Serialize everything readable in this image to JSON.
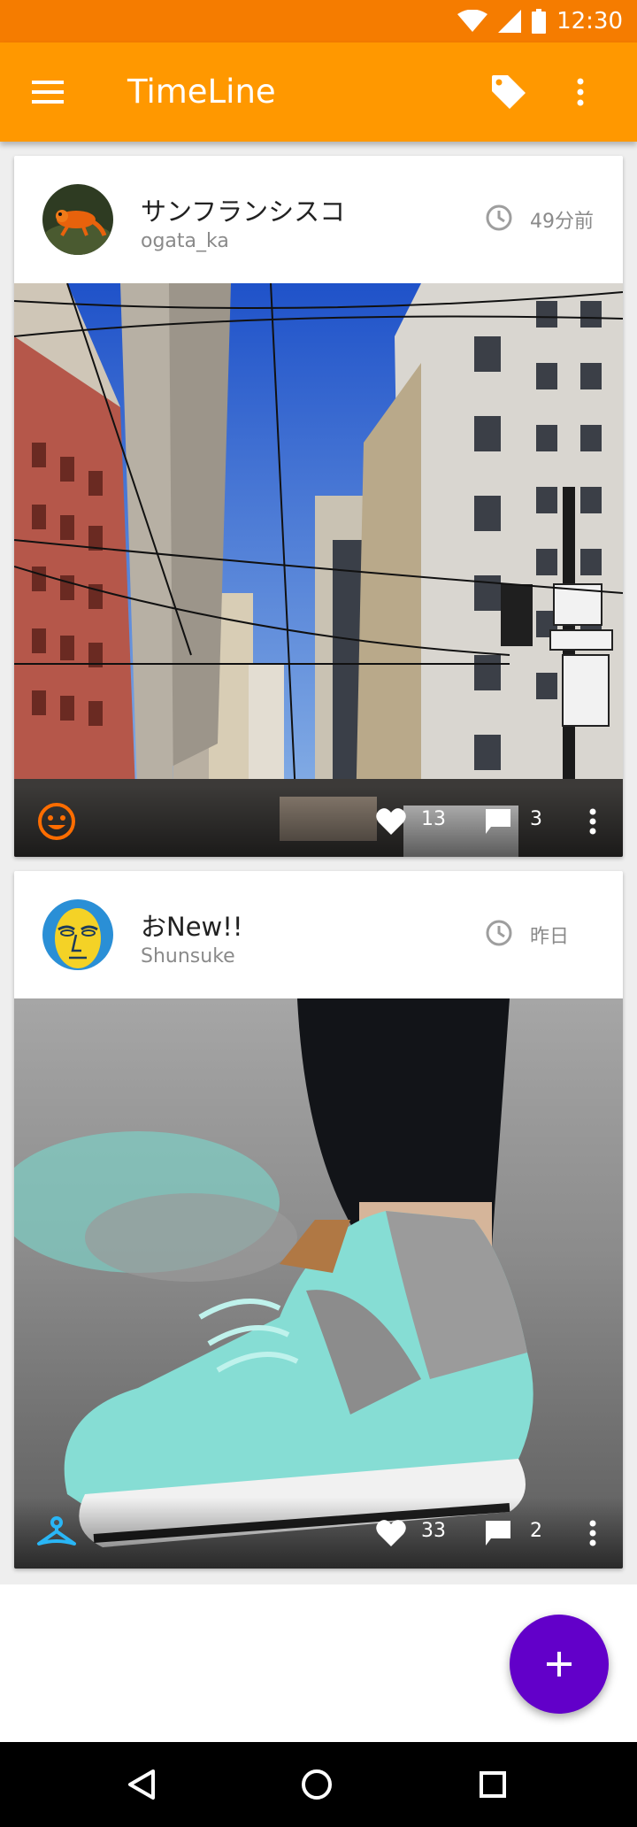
{
  "status_bar": {
    "time": "12:30",
    "icons": [
      "wifi-icon",
      "cell-signal-icon",
      "battery-icon"
    ]
  },
  "app_bar": {
    "title": "TimeLine",
    "icons": [
      "menu-icon",
      "tag-icon",
      "more-vert-icon"
    ],
    "color": "#ff9800"
  },
  "posts": [
    {
      "title": "サンフランシスコ",
      "user": "ogata_ka",
      "time": "49分前",
      "likes": "13",
      "comments": "3",
      "badge_icon": "smiley-face-icon",
      "badge_color": "#ff6d00",
      "photo": "san-francisco-street"
    },
    {
      "title": "おNew!!",
      "user": "Shunsuke",
      "time": "昨日",
      "likes": "33",
      "comments": "2",
      "badge_icon": "hanger-icon",
      "badge_color": "#29b6f6",
      "photo": "mint-sneaker"
    }
  ],
  "fab": {
    "icon": "plus-icon",
    "color": "#6200c9"
  },
  "nav_bar": {
    "icons": [
      "back-icon",
      "home-icon",
      "recents-icon"
    ]
  }
}
